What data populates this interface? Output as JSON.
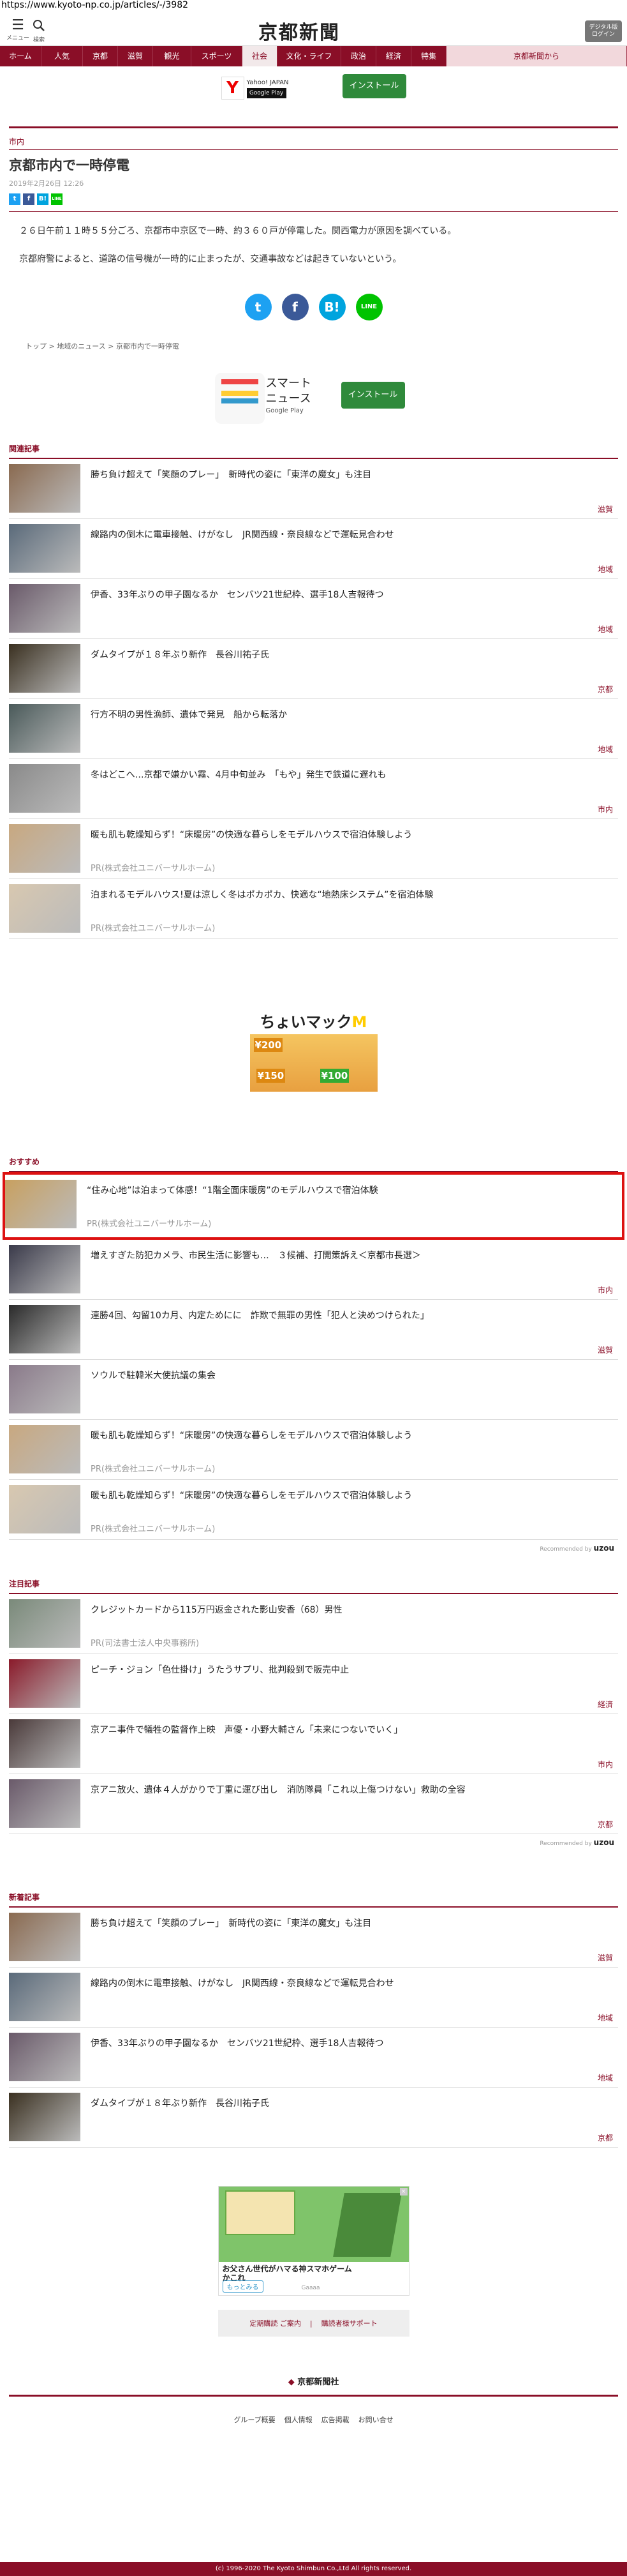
{
  "url": "https://www.kyoto-np.co.jp/articles/-/3982",
  "header": {
    "menu_label": "メニュー",
    "search_label": "検索",
    "logo": "京都新聞",
    "digital": "デジタル版\nログイン"
  },
  "nav": [
    "ホーム",
    "人気",
    "京都",
    "滋賀",
    "観光",
    "スポーツ",
    "社会",
    "文化・ライフ",
    "政治",
    "経済",
    "特集",
    "京都新聞から"
  ],
  "ad1": {
    "store": "Yahoo! JAPAN",
    "gp": "Google Play",
    "install": "インストール"
  },
  "article": {
    "category": "市内",
    "title": "京都市内で一時停電",
    "date": "2019年2月26日 12:26",
    "p1": "２６日午前１１時５５分ごろ、京都市中京区で一時、約３６０戸が停電した。関西電力が原因を調べている。",
    "p2": "京都府警によると、道路の信号機が一時的に止まったが、交通事故などは起きていないという。"
  },
  "share": {
    "tw": "t",
    "fb": "f",
    "hb": "B!",
    "line": "LINE"
  },
  "breadcrumb": [
    "トップ",
    "地域のニュース",
    "京都市内で一時停電"
  ],
  "ad2": {
    "name1": "スマート",
    "name2": "ニュース",
    "gp": "Google Play",
    "install": "インストール"
  },
  "related": {
    "title": "関連記事",
    "items": [
      {
        "text": "勝ち負け超えて「笑顔のプレー」　新時代の姿に「東洋の魔女」も注目",
        "tag": "滋賀",
        "c": "#8a6a50"
      },
      {
        "text": "線路内の倒木に電車接触、けがなし　JR関西線・奈良線などで運転見合わせ",
        "tag": "地域",
        "c": "#5a6a7a"
      },
      {
        "text": "伊香、33年ぶりの甲子園なるか　センバツ21世紀枠、選手18人吉報待つ",
        "tag": "地域",
        "c": "#6a5a6a"
      },
      {
        "text": "ダムタイプが１８年ぶり新作　長谷川祐子氏",
        "tag": "京都",
        "c": "#3a3020"
      },
      {
        "text": "行方不明の男性漁師、遺体で発見　船から転落か",
        "tag": "地域",
        "c": "#4a5a5a"
      },
      {
        "text": "冬はどこへ…京都で嫌かい霧、4月中旬並み　「もや」発生で鉄道に遅れも",
        "tag": "市内",
        "c": "#8a8a8a"
      },
      {
        "text": "暖も肌も乾燥知らず！“床暖房”の快適な暮らしをモデルハウスで宿泊体験しよう",
        "pr": "PR(株式会社ユニバーサルホーム)",
        "c": "#c8a880"
      },
      {
        "text": "泊まれるモデルハウス!夏は涼しく冬はポカポカ、快適な“地熱床システム”を宿泊体験",
        "pr": "PR(株式会社ユニバーサルホーム)",
        "c": "#d8c8b0"
      }
    ]
  },
  "mcd": {
    "brand": "ちょいマック",
    "p1": "¥200",
    "p2": "¥150",
    "p3": "¥100"
  },
  "recommend": {
    "title": "おすすめ",
    "items": [
      {
        "text": "“住み心地”は泊まって体感！“1階全面床暖房”のモデルハウスで宿泊体験",
        "pr": "PR(株式会社ユニバーサルホーム)",
        "c": "#c8a060",
        "hl": true
      },
      {
        "text": "増えすぎた防犯カメラ、市民生活に影響も…　３候補、打開策訴え＜京都市長選＞",
        "tag": "市内",
        "c": "#3a3a4a"
      },
      {
        "text": "連勝4回、勾留10カ月、内定ためにに　詐欺で無罪の男性「犯人と決めつけられた」",
        "tag": "滋賀",
        "c": "#2a2a2a"
      },
      {
        "text": "ソウルで駐韓米大使抗議の集会",
        "c": "#8a7a8a"
      },
      {
        "text": "暖も肌も乾燥知らず！“床暖房”の快適な暮らしをモデルハウスで宿泊体験しよう",
        "pr": "PR(株式会社ユニバーサルホーム)",
        "c": "#c8a880"
      },
      {
        "text": "暖も肌も乾燥知らず！“床暖房”の快適な暮らしをモデルハウスで宿泊体験しよう",
        "pr": "PR(株式会社ユニバーサルホーム)",
        "c": "#d8c8b0"
      }
    ],
    "powered": "Recommended by",
    "brand": "uzou"
  },
  "featured": {
    "title": "注目記事",
    "items": [
      {
        "text": "クレジットカードから115万円返金された影山安香（68）男性",
        "pr": "PR(司法書士法人中央事務所)",
        "c": "#7a8a7a"
      },
      {
        "text": "ピーチ・ジョン「色仕掛け」うたうサプリ、批判殺到で販売中止",
        "tag": "経済",
        "c": "#8a1a2a"
      },
      {
        "text": "京アニ事件で犠牲の監督作上映　声優・小野大輔さん「未来につないでいく」",
        "tag": "市内",
        "c": "#4a3a3a"
      },
      {
        "text": "京アニ放火、遺体４人がかりで丁重に運び出し　消防隊員「これ以上傷つけない」救助の全容",
        "tag": "京都",
        "c": "#6a5a6a"
      }
    ],
    "powered": "Recommended by",
    "brand": "uzou"
  },
  "latest": {
    "title": "新着記事",
    "items": [
      {
        "text": "勝ち負け超えて「笑顔のプレー」　新時代の姿に「東洋の魔女」も注目",
        "tag": "滋賀",
        "c": "#8a6a50"
      },
      {
        "text": "線路内の倒木に電車接触、けがなし　JR関西線・奈良線などで運転見合わせ",
        "tag": "地域",
        "c": "#5a6a7a"
      },
      {
        "text": "伊香、33年ぶりの甲子園なるか　センバツ21世紀枠、選手18人吉報待つ",
        "tag": "地域",
        "c": "#6a5a6a"
      },
      {
        "text": "ダムタイプが１８年ぶり新作　長谷川祐子氏",
        "tag": "京都",
        "c": "#3a3020"
      }
    ]
  },
  "gamead": {
    "caption": "お父さん世代がハマる神スマホゲーム\nかこれ",
    "more": "もっとみる",
    "brand": "Gaaaa"
  },
  "links": {
    "a": "定期購読 ご案内",
    "b": "購読者様サポート"
  },
  "footer": {
    "company": "京都新聞社",
    "links": [
      "グループ概要",
      "個人情報",
      "広告掲載",
      "お問い合せ"
    ],
    "copy": "(c) 1996-2020 The Kyoto Shimbun Co.,Ltd All rights reserved."
  }
}
